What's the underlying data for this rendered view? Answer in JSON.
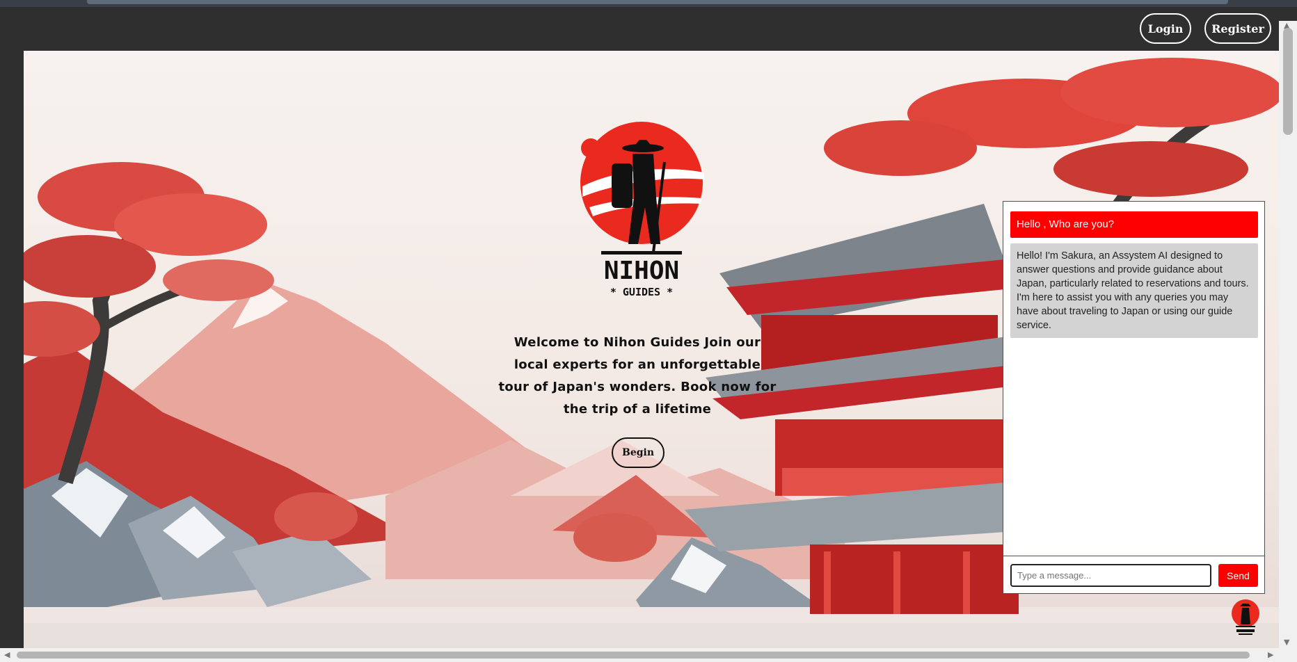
{
  "header": {
    "login_label": "Login",
    "register_label": "Register"
  },
  "hero": {
    "logo_text": "NIHON",
    "logo_subtext": "* GUIDES *",
    "welcome_text": "Welcome to Nihon Guides Join our local experts for an unforgettable tour of Japan's wonders. Book now for the trip of a lifetime",
    "begin_label": "Begin"
  },
  "chat": {
    "user_message": "Hello , Who are you?",
    "bot_message": "Hello! I'm Sakura, an Assystem AI designed to answer questions and provide guidance about Japan, particularly related to reservations and tours. I'm here to assist you with any queries you may have about traveling to Japan or using our guide service.",
    "input_placeholder": "Type a message...",
    "send_label": "Send"
  },
  "colors": {
    "accent": "#ff0000",
    "dark_bg": "#2f2f2f",
    "bot_bubble": "#d3d3d3"
  },
  "icons": {
    "logo": "samurai-traveler-sun-logo",
    "chat_toggle": "nihon-guides-mini-logo-icon"
  }
}
